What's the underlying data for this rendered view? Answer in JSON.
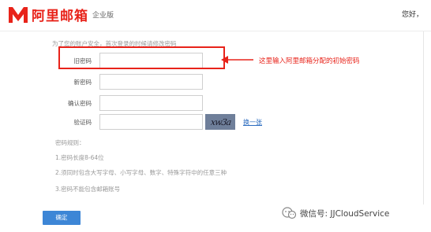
{
  "header": {
    "logo_text": "阿里邮箱",
    "edition": "企业版",
    "greeting": "您好，"
  },
  "notice": "为了您的账户安全，首次登录的时候请修改密码",
  "form": {
    "old_password_label": "旧密码",
    "new_password_label": "新密码",
    "confirm_password_label": "确认密码",
    "captcha_label": "验证码",
    "captcha_text": "xw3a",
    "refresh_link": "换一张"
  },
  "annotation": "这里输入阿里邮箱分配的初始密码",
  "rules": {
    "title": "密码规则：",
    "items": [
      "1.密码长度8-64位",
      "2.须同时包含大写字母、小写字母、数字、特殊字符中的任意三种",
      "3.密码不能包含邮箱账号"
    ]
  },
  "confirm_button": "确定",
  "watermark": "微信号: JJCloudService",
  "colors": {
    "brand": "#e8231a",
    "button": "#3d86d6",
    "link": "#2a6bbf"
  }
}
